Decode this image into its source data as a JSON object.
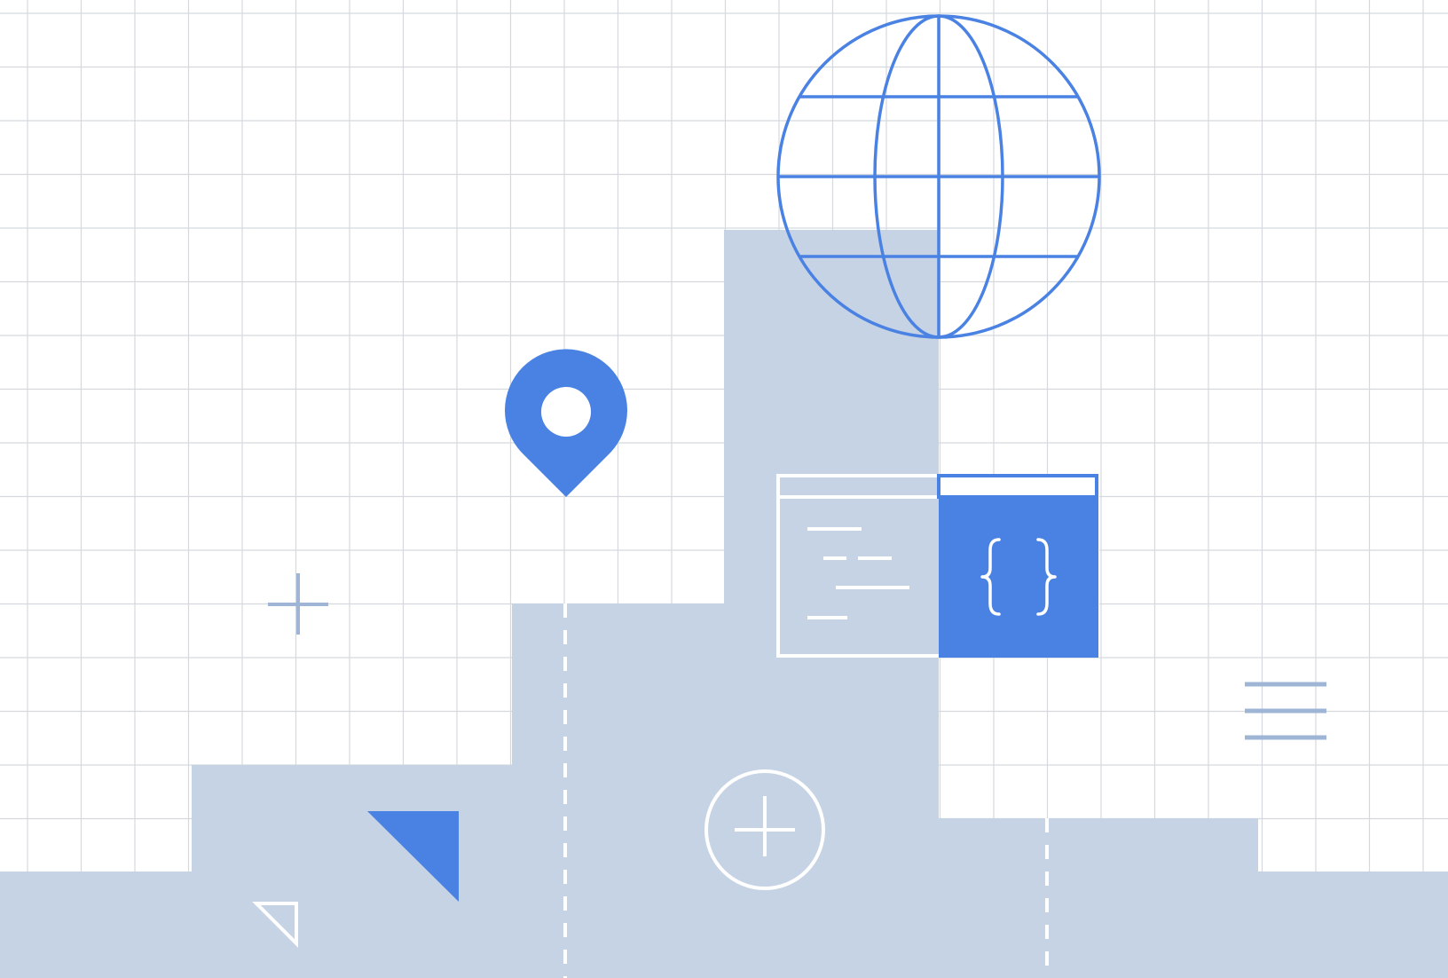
{
  "illustration": {
    "theme": "web-api-and-maps",
    "background_color": "#ffffff",
    "grid_color": "#d5d9de",
    "block_color": "#c6d3e4",
    "accent_color": "#4a82e3",
    "muted_accent_color": "#9fb5d6",
    "line_on_block_color": "#ffffff",
    "icons": [
      "globe-icon",
      "map-pin-icon",
      "code-window-icon",
      "curly-braces-icon",
      "plus-icon",
      "plus-circle-icon",
      "menu-lines-icon",
      "triangle-icon",
      "triangle-outline-icon"
    ]
  }
}
